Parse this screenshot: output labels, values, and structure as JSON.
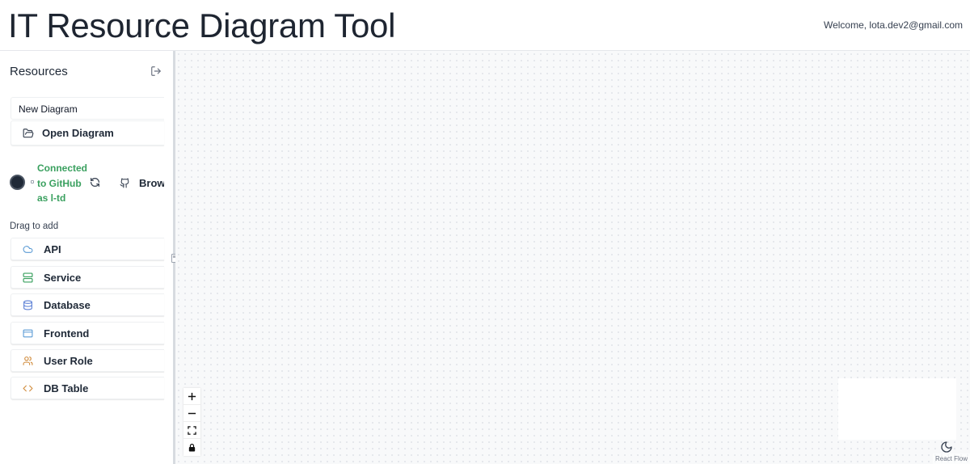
{
  "header": {
    "title": "IT Resource Diagram Tool",
    "welcome": "Welcome, lota.dev2@gmail.com"
  },
  "sidebar": {
    "title": "Resources",
    "logout_icon": "logout-icon",
    "new_diagram_value": "New Diagram",
    "open_diagram_label": "Open Diagram",
    "github": {
      "status": "Connected to GitHub as l-td",
      "browse_label": "Browse",
      "status_color": "#3aa05f"
    },
    "drag_label": "Drag to add",
    "palette": [
      {
        "label": "API",
        "icon": "cloud-icon",
        "color": "#5b9bd5"
      },
      {
        "label": "Service",
        "icon": "server-icon",
        "color": "#3aa05f"
      },
      {
        "label": "Database",
        "icon": "database-icon",
        "color": "#5b7fd5"
      },
      {
        "label": "Frontend",
        "icon": "browser-window-icon",
        "color": "#5b9bd5"
      },
      {
        "label": "User Role",
        "icon": "users-icon",
        "color": "#d08a3a"
      },
      {
        "label": "DB Table",
        "icon": "code-icon",
        "color": "#d08a3a"
      }
    ]
  },
  "canvas": {
    "controls": [
      "zoom-in-icon",
      "zoom-out-icon",
      "fit-view-icon",
      "lock-icon"
    ],
    "theme_icon": "moon-icon",
    "attribution": "React Flow"
  }
}
